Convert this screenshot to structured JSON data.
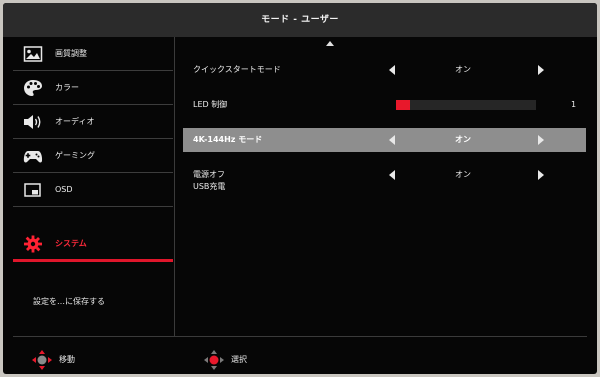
{
  "title": "モード - ユーザー",
  "sidebar": {
    "items": [
      {
        "label": "画質調整",
        "icon": "picture-icon"
      },
      {
        "label": "カラー",
        "icon": "palette-icon"
      },
      {
        "label": "オーディオ",
        "icon": "speaker-icon"
      },
      {
        "label": "ゲーミング",
        "icon": "gamepad-icon"
      },
      {
        "label": "OSD",
        "icon": "osd-window-icon"
      },
      {
        "label": "システム",
        "icon": "gear-icon",
        "active": true
      }
    ],
    "save_label": "設定を…に保存する"
  },
  "settings": {
    "quick_start": {
      "label": "クイックスタートモード",
      "value": "オン"
    },
    "led": {
      "label": "LED 制御",
      "level": 0.1,
      "value": "1"
    },
    "refresh": {
      "label": "4K-144Hz モード",
      "value": "オン",
      "highlighted": true
    },
    "power_off_usb": {
      "label": "電源オフ",
      "sublabel": "USB充電",
      "value": "オン"
    }
  },
  "footer": {
    "move_label": "移動",
    "select_label": "選択"
  },
  "colors": {
    "accent": "#e0162b",
    "highlight_row": "#8e8e8e",
    "background": "#060606",
    "title_bar": "#2b2b2b"
  }
}
